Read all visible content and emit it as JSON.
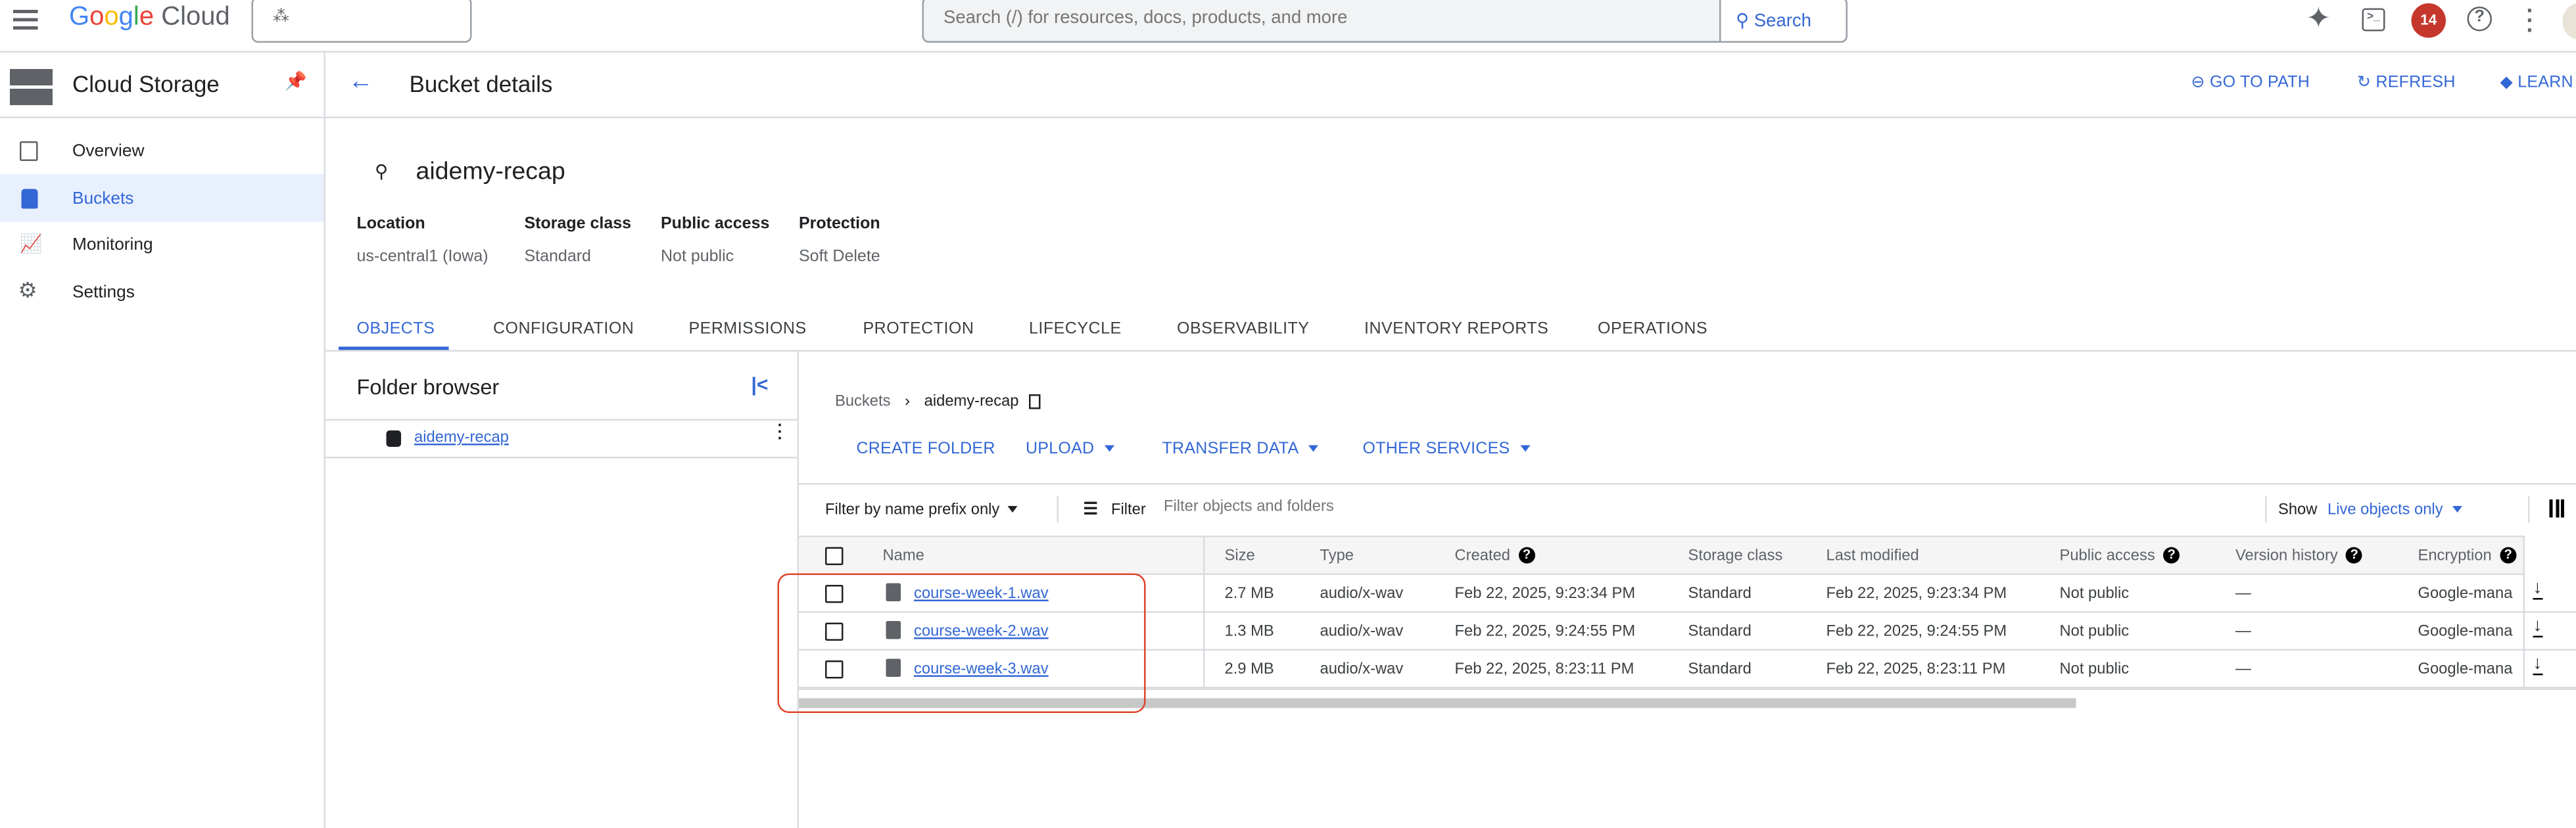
{
  "topbar": {
    "logo": "Google Cloud",
    "search_placeholder": "Search (/) for resources, docs, products, and more",
    "search_button": "Search",
    "notification_count": "14",
    "colors": {
      "badge": "#c5372c",
      "accent": "#3367d6"
    }
  },
  "product": {
    "title": "Cloud Storage"
  },
  "sidebar": {
    "items": [
      {
        "label": "Overview",
        "icon": "dashboard-icon"
      },
      {
        "label": "Buckets",
        "icon": "bucket-icon",
        "active": true
      },
      {
        "label": "Monitoring",
        "icon": "monitoring-icon"
      },
      {
        "label": "Settings",
        "icon": "gear-icon"
      }
    ]
  },
  "header": {
    "title": "Bucket details",
    "actions": [
      "GO TO PATH",
      "REFRESH",
      "LEARN"
    ]
  },
  "bucket": {
    "name": "aidemy-recap",
    "meta": [
      {
        "label": "Location",
        "value": "us-central1 (Iowa)"
      },
      {
        "label": "Storage class",
        "value": "Standard"
      },
      {
        "label": "Public access",
        "value": "Not public"
      },
      {
        "label": "Protection",
        "value": "Soft Delete"
      }
    ]
  },
  "tabs": [
    "OBJECTS",
    "CONFIGURATION",
    "PERMISSIONS",
    "PROTECTION",
    "LIFECYCLE",
    "OBSERVABILITY",
    "INVENTORY REPORTS",
    "OPERATIONS"
  ],
  "active_tab": "OBJECTS",
  "folder_browser": {
    "title": "Folder browser",
    "items": [
      "aidemy-recap"
    ]
  },
  "objects": {
    "breadcrumb": [
      "Buckets",
      "aidemy-recap"
    ],
    "actions": [
      "CREATE FOLDER",
      "UPLOAD",
      "TRANSFER DATA",
      "OTHER SERVICES"
    ],
    "filter_mode": "Filter by name prefix only",
    "filter_label": "Filter",
    "filter_placeholder": "Filter objects and folders",
    "show_label": "Show",
    "show_value": "Live objects only",
    "columns": [
      "Name",
      "Size",
      "Type",
      "Created",
      "Storage class",
      "Last modified",
      "Public access",
      "Version history",
      "Encryption"
    ],
    "rows": [
      {
        "name": "course-week-1.wav",
        "size": "2.7 MB",
        "type": "audio/x-wav",
        "created": "Feb 22, 2025, 9:23:34 PM",
        "storage_class": "Standard",
        "last_modified": "Feb 22, 2025, 9:23:34 PM",
        "public_access": "Not public",
        "version_history": "—",
        "encryption": "Google-mana"
      },
      {
        "name": "course-week-2.wav",
        "size": "1.3 MB",
        "type": "audio/x-wav",
        "created": "Feb 22, 2025, 9:24:55 PM",
        "storage_class": "Standard",
        "last_modified": "Feb 22, 2025, 9:24:55 PM",
        "public_access": "Not public",
        "version_history": "—",
        "encryption": "Google-mana"
      },
      {
        "name": "course-week-3.wav",
        "size": "2.9 MB",
        "type": "audio/x-wav",
        "created": "Feb 22, 2025, 8:23:11 PM",
        "storage_class": "Standard",
        "last_modified": "Feb 22, 2025, 8:23:11 PM",
        "public_access": "Not public",
        "version_history": "—",
        "encryption": "Google-mana"
      }
    ]
  },
  "annotation_color": "#e0442b"
}
